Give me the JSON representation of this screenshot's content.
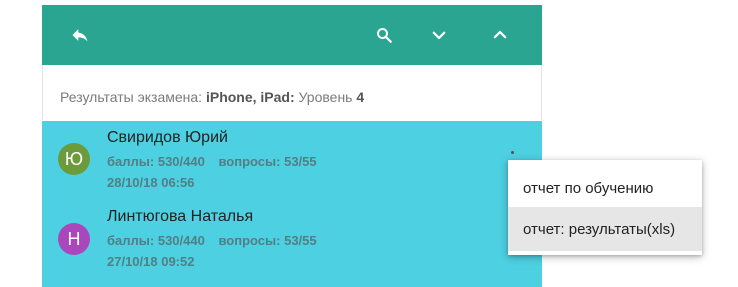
{
  "toolbar": {
    "back_icon": "reply-arrow-icon",
    "search_icon": "search-icon",
    "down_icon": "chevron-down-icon",
    "up_icon": "chevron-up-icon",
    "color": "#2aa592"
  },
  "header": {
    "prefix": "Результаты экзамена:",
    "course": "iPhone, iPad:",
    "level_label": "Уровень",
    "level_value": "4"
  },
  "list": {
    "background": "#4dd0e1",
    "items": [
      {
        "initial": "Ю",
        "avatar_color": "#6b9b3a",
        "name": "Свиридов Юрий",
        "score_label": "баллы:",
        "score": "530/440",
        "questions_label": "вопросы:",
        "questions": "53/55",
        "date": "28/10/18 06:56"
      },
      {
        "initial": "Н",
        "avatar_color": "#ab47bc",
        "name": "Линтюгова Наталья",
        "score_label": "баллы:",
        "score": "530/440",
        "questions_label": "вопросы:",
        "questions": "53/55",
        "date": "27/10/18 09:52"
      }
    ]
  },
  "menu": {
    "items": [
      {
        "label": "отчет по обучению",
        "highlighted": false
      },
      {
        "label": "отчет: результаты(xls)",
        "highlighted": true
      }
    ]
  }
}
